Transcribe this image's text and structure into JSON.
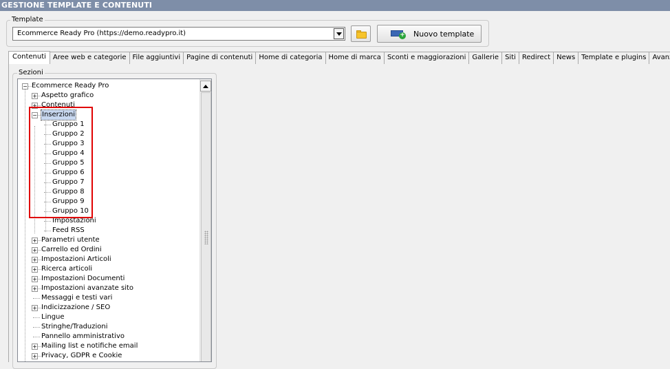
{
  "window": {
    "title": "GESTIONE TEMPLATE E CONTENUTI"
  },
  "template": {
    "legend": "Template",
    "selected": "Ecommerce Ready Pro (https://demo.readypro.it)",
    "new_button_label": "Nuovo template"
  },
  "tabs": [
    {
      "label": "Contenuti",
      "active": true
    },
    {
      "label": "Aree web e categorie"
    },
    {
      "label": "File aggiuntivi"
    },
    {
      "label": "Pagine di contenuti"
    },
    {
      "label": "Home di categoria"
    },
    {
      "label": "Home di marca"
    },
    {
      "label": "Sconti e maggiorazioni"
    },
    {
      "label": "Gallerie"
    },
    {
      "label": "Siti"
    },
    {
      "label": "Redirect"
    },
    {
      "label": "News"
    },
    {
      "label": "Template e plugins"
    },
    {
      "label": "Avanzate"
    }
  ],
  "sections": {
    "legend": "Sezioni",
    "tree": [
      {
        "label": "Ecommerce Ready Pro",
        "level": 0,
        "expander": "minus"
      },
      {
        "label": "Aspetto grafico",
        "level": 1,
        "expander": "plus"
      },
      {
        "label": "Contenuti",
        "level": 1,
        "expander": "plus"
      },
      {
        "label": "Inserzioni",
        "level": 1,
        "expander": "minus",
        "selected": true
      },
      {
        "label": "Gruppo 1",
        "level": 2
      },
      {
        "label": "Gruppo 2",
        "level": 2
      },
      {
        "label": "Gruppo 3",
        "level": 2
      },
      {
        "label": "Gruppo 4",
        "level": 2
      },
      {
        "label": "Gruppo 5",
        "level": 2
      },
      {
        "label": "Gruppo 6",
        "level": 2
      },
      {
        "label": "Gruppo 7",
        "level": 2
      },
      {
        "label": "Gruppo 8",
        "level": 2
      },
      {
        "label": "Gruppo 9",
        "level": 2
      },
      {
        "label": "Gruppo 10",
        "level": 2
      },
      {
        "label": "Impostazioni",
        "level": 2
      },
      {
        "label": "Feed RSS",
        "level": 2
      },
      {
        "label": "Parametri utente",
        "level": 1,
        "expander": "plus"
      },
      {
        "label": "Carrello ed Ordini",
        "level": 1,
        "expander": "plus"
      },
      {
        "label": "Impostazioni Articoli",
        "level": 1,
        "expander": "plus"
      },
      {
        "label": "Ricerca articoli",
        "level": 1,
        "expander": "plus"
      },
      {
        "label": "Impostazioni Documenti",
        "level": 1,
        "expander": "plus"
      },
      {
        "label": "Impostazioni avanzate sito",
        "level": 1,
        "expander": "plus"
      },
      {
        "label": "Messaggi e testi vari",
        "level": 1
      },
      {
        "label": "Indicizzazione / SEO",
        "level": 1,
        "expander": "plus"
      },
      {
        "label": "Lingue",
        "level": 1
      },
      {
        "label": "Stringhe/Traduzioni",
        "level": 1
      },
      {
        "label": "Pannello amministrativo",
        "level": 1
      },
      {
        "label": "Mailing list e notifiche email",
        "level": 1,
        "expander": "plus"
      },
      {
        "label": "Privacy, GDPR e Cookie",
        "level": 1,
        "expander": "plus"
      }
    ]
  },
  "colors": {
    "titlebar": "#7e8ea8",
    "highlight_box": "#e00000",
    "selection": "#c8d8f0"
  },
  "icons": {
    "folder_button": "folder-icon",
    "new_template": "add-template-icon"
  }
}
